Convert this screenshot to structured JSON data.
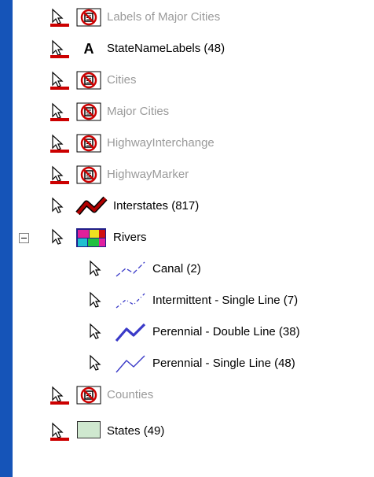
{
  "layers": [
    {
      "label": "Labels of Major Cities",
      "enabled": false,
      "symbol": "no-label-icon",
      "sel": "red"
    },
    {
      "label": "StateNameLabels (48)",
      "enabled": true,
      "symbol": "text-a-icon",
      "sel": "red"
    },
    {
      "label": "Cities",
      "enabled": false,
      "symbol": "no-label-icon",
      "sel": "red"
    },
    {
      "label": "Major Cities",
      "enabled": false,
      "symbol": "no-label-icon",
      "sel": "red"
    },
    {
      "label": "HighwayInterchange",
      "enabled": false,
      "symbol": "no-label-icon",
      "sel": "red"
    },
    {
      "label": "HighwayMarker",
      "enabled": false,
      "symbol": "no-label-icon",
      "sel": "red"
    },
    {
      "label": "Interstates (817)",
      "enabled": true,
      "symbol": "interstate-line-icon",
      "sel": "plain"
    },
    {
      "label": "Rivers",
      "enabled": true,
      "symbol": "rivers-group-icon",
      "sel": "plain",
      "expander": "minus"
    },
    {
      "label": "Canal (2)",
      "enabled": true,
      "symbol": "dash-line-icon",
      "sel": "plain"
    },
    {
      "label": "Intermittent - Single Line (7)",
      "enabled": true,
      "symbol": "dot-line-icon",
      "sel": "plain"
    },
    {
      "label": "Perennial - Double Line (38)",
      "enabled": true,
      "symbol": "thick-line-icon",
      "sel": "plain"
    },
    {
      "label": "Perennial - Single Line (48)",
      "enabled": true,
      "symbol": "thin-line-icon",
      "sel": "plain"
    },
    {
      "label": "Counties",
      "enabled": false,
      "symbol": "no-label-icon",
      "sel": "red"
    },
    {
      "label": "States (49)",
      "enabled": true,
      "symbol": "state-patch-icon",
      "sel": "red"
    }
  ],
  "colors": {
    "background": "#1554b8",
    "disabled_text": "#9a9a9a",
    "selection_red": "#cc0000",
    "interstate": "#b00000",
    "river_blue": "#3a3ac8",
    "state_fill": "#cfe8cf"
  }
}
